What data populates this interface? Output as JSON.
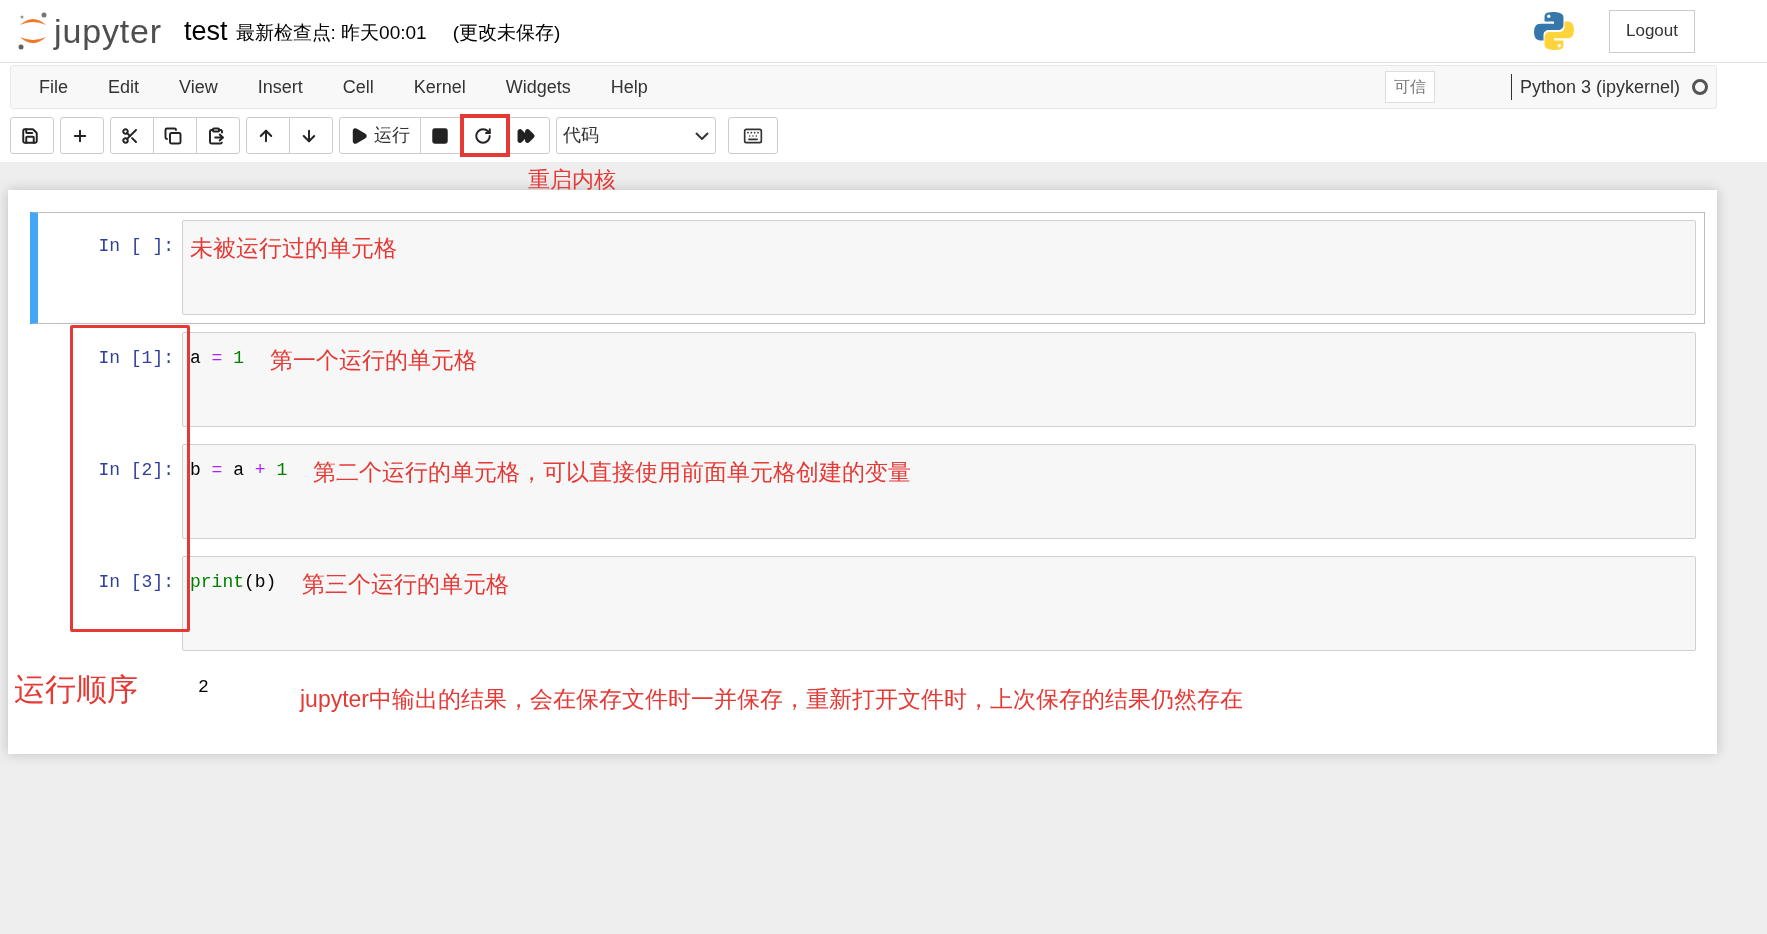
{
  "header": {
    "logo_text": "jupyter",
    "notebook_name": "test",
    "checkpoint": "最新检查点: 昨天00:01",
    "unsaved": "(更改未保存)",
    "logout": "Logout"
  },
  "menu": {
    "items": [
      "File",
      "Edit",
      "View",
      "Insert",
      "Cell",
      "Kernel",
      "Widgets",
      "Help"
    ],
    "trusted": "可信",
    "kernel": "Python 3 (ipykernel)",
    "kernel_busy": false
  },
  "toolbar": {
    "groups": [
      [
        {
          "kind": "save",
          "highlighted": false
        }
      ],
      [
        {
          "kind": "add",
          "highlighted": false
        }
      ],
      [
        {
          "kind": "cut",
          "highlighted": false
        },
        {
          "kind": "copy",
          "highlighted": false
        },
        {
          "kind": "paste",
          "highlighted": false
        }
      ],
      [
        {
          "kind": "up",
          "highlighted": false
        },
        {
          "kind": "down",
          "highlighted": false
        }
      ],
      [
        {
          "kind": "run",
          "label": "运行",
          "highlighted": false
        },
        {
          "kind": "stop",
          "highlighted": false
        },
        {
          "kind": "restart",
          "highlighted": true,
          "note": "重启内核"
        },
        {
          "kind": "restart-run",
          "highlighted": false
        }
      ]
    ],
    "cell_type": "代码"
  },
  "cells": [
    {
      "prompt": "In [ ]:",
      "selected": true,
      "note": "未被运行过的单元格"
    },
    {
      "prompt": "In [1]:",
      "selected": false,
      "code": [
        {
          "text": "a",
          "kind": "name"
        },
        {
          "text": "=",
          "kind": "op"
        },
        {
          "text": "1",
          "kind": "num"
        }
      ],
      "note": "第一个运行的单元格"
    },
    {
      "prompt": "In [2]:",
      "selected": false,
      "code": [
        {
          "text": "b",
          "kind": "name"
        },
        {
          "text": "=",
          "kind": "op"
        },
        {
          "text": "a",
          "kind": "name"
        },
        {
          "text": "+",
          "kind": "op"
        },
        {
          "text": "1",
          "kind": "num"
        }
      ],
      "note": "第二个运行的单元格，可以直接使用前面单元格创建的变量"
    },
    {
      "prompt": "In [3]:",
      "selected": false,
      "code": [
        {
          "text": "print",
          "kind": "builtin"
        },
        {
          "text": "(b)",
          "kind": "name"
        }
      ],
      "note": "第三个运行的单元格"
    }
  ],
  "run_order_note": "运行顺序",
  "output": {
    "text": "2",
    "note": "jupyter中输出的结果，会在保存文件时一并保存，重新打开文件时，上次保存的结果仍然存在"
  }
}
